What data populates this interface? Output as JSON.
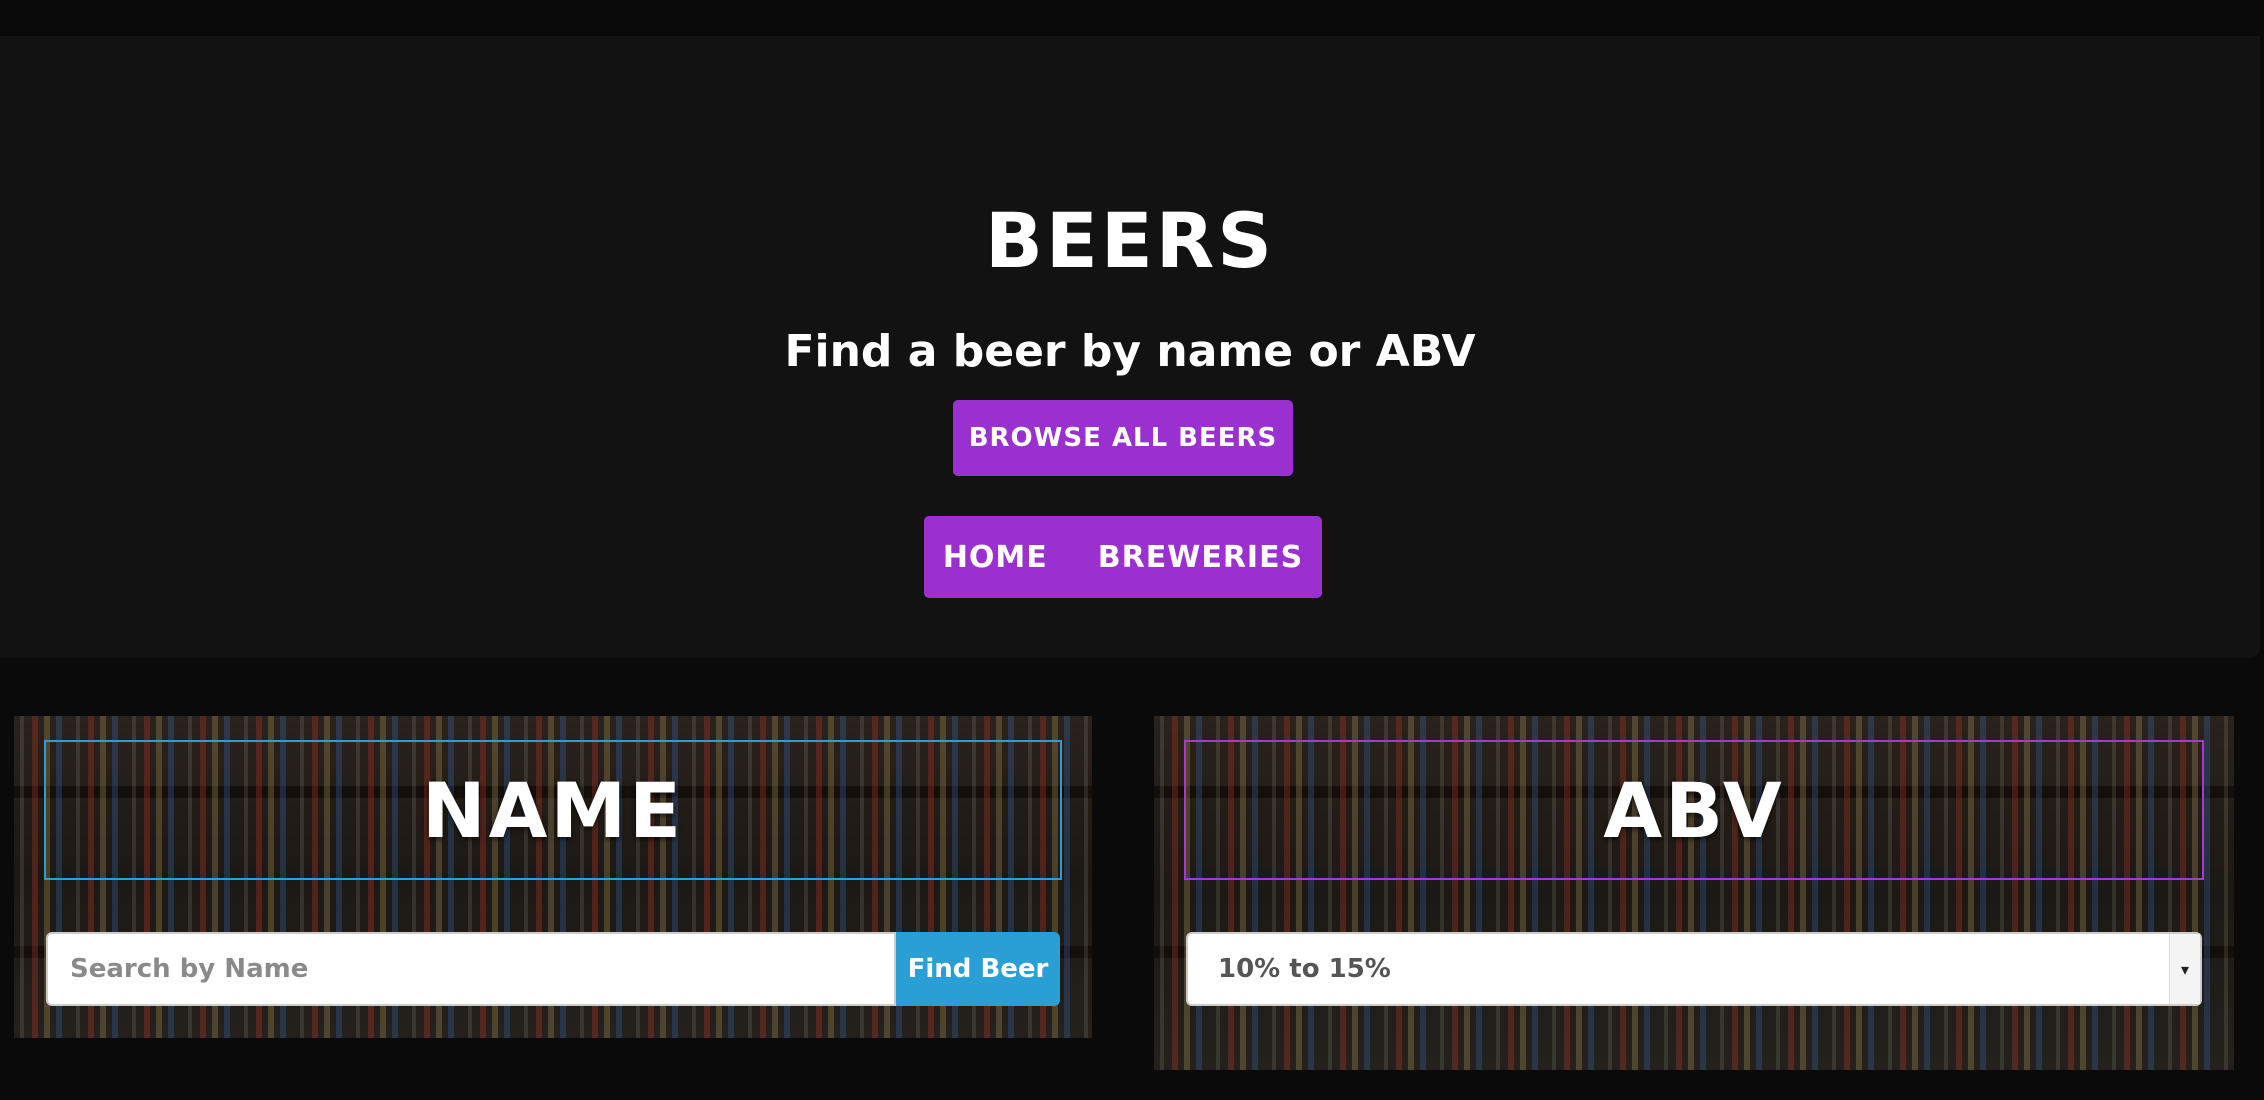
{
  "hero": {
    "title": "BEERS",
    "subtitle": "Find a beer by name or ABV",
    "browse_label": "BROWSE ALL BEERS"
  },
  "nav": {
    "items": [
      {
        "label": "HOME"
      },
      {
        "label": "BREWERIES"
      }
    ]
  },
  "name_card": {
    "title": "NAME",
    "placeholder": "Search by Name",
    "button_label": "Find Beer"
  },
  "abv_card": {
    "title": "ABV",
    "selected": "10% to 15%"
  },
  "colors": {
    "accent_purple": "#9b30d0",
    "accent_blue": "#2a9fd6",
    "hero_bg": "#121212",
    "page_bg": "#0a0a0a"
  },
  "icons": {
    "select_caret": "caret-down-icon"
  }
}
